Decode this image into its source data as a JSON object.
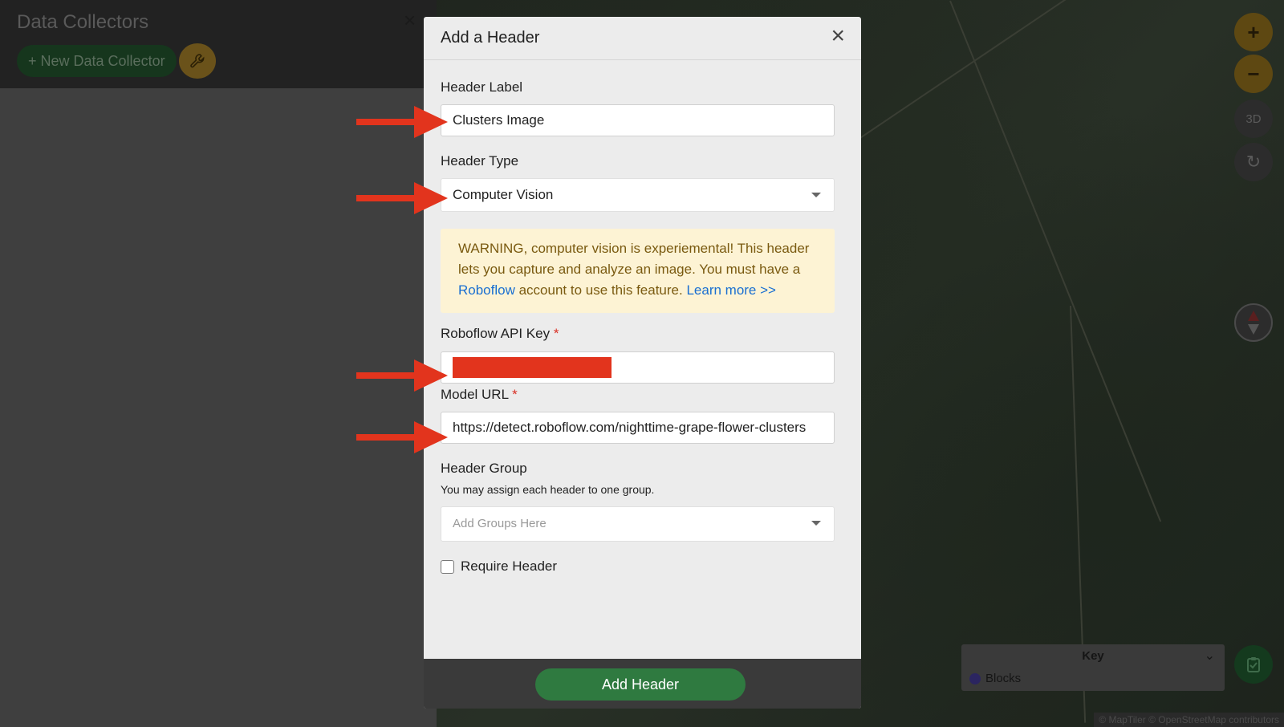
{
  "sidebar": {
    "title": "Data Collectors",
    "close_icon": "×",
    "new_button_label": "+ New Data Collector",
    "wrench_icon": "wrench-icon"
  },
  "map": {
    "zoom_in": "+",
    "zoom_out": "−",
    "three_d": "3D",
    "rotate_icon": "↻",
    "clipboard_icon": "📋",
    "key": {
      "title": "Key",
      "items": [
        {
          "label": "Blocks",
          "color": "#2b2560"
        }
      ]
    },
    "attribution": "© MapTiler © OpenStreetMap contributors"
  },
  "modal": {
    "title": "Add a Header",
    "close_icon": "×",
    "header_label": {
      "label": "Header Label",
      "value": "Clusters Image"
    },
    "header_type": {
      "label": "Header Type",
      "value": "Computer Vision"
    },
    "warning": {
      "text1": "WARNING, computer vision is experiemental! This header lets you capture and analyze an image. You must have a ",
      "link1": "Roboflow",
      "text2": " account to use this feature. ",
      "link2": "Learn more >>"
    },
    "api_key": {
      "label": "Roboflow API Key",
      "required": "*"
    },
    "model_url": {
      "label": "Model URL",
      "required": "*",
      "value": "https://detect.roboflow.com/nighttime-grape-flower-clusters"
    },
    "header_group": {
      "label": "Header Group",
      "helper": "You may assign each header to one group.",
      "placeholder": "Add Groups Here"
    },
    "require_header": {
      "label": "Require Header",
      "checked": false
    },
    "submit_label": "Add Header"
  },
  "colors": {
    "accent_green": "#2f7a40",
    "annotation_red": "#e2341d",
    "warning_bg": "#fdf3d4",
    "link_blue": "#1a6fd1"
  }
}
